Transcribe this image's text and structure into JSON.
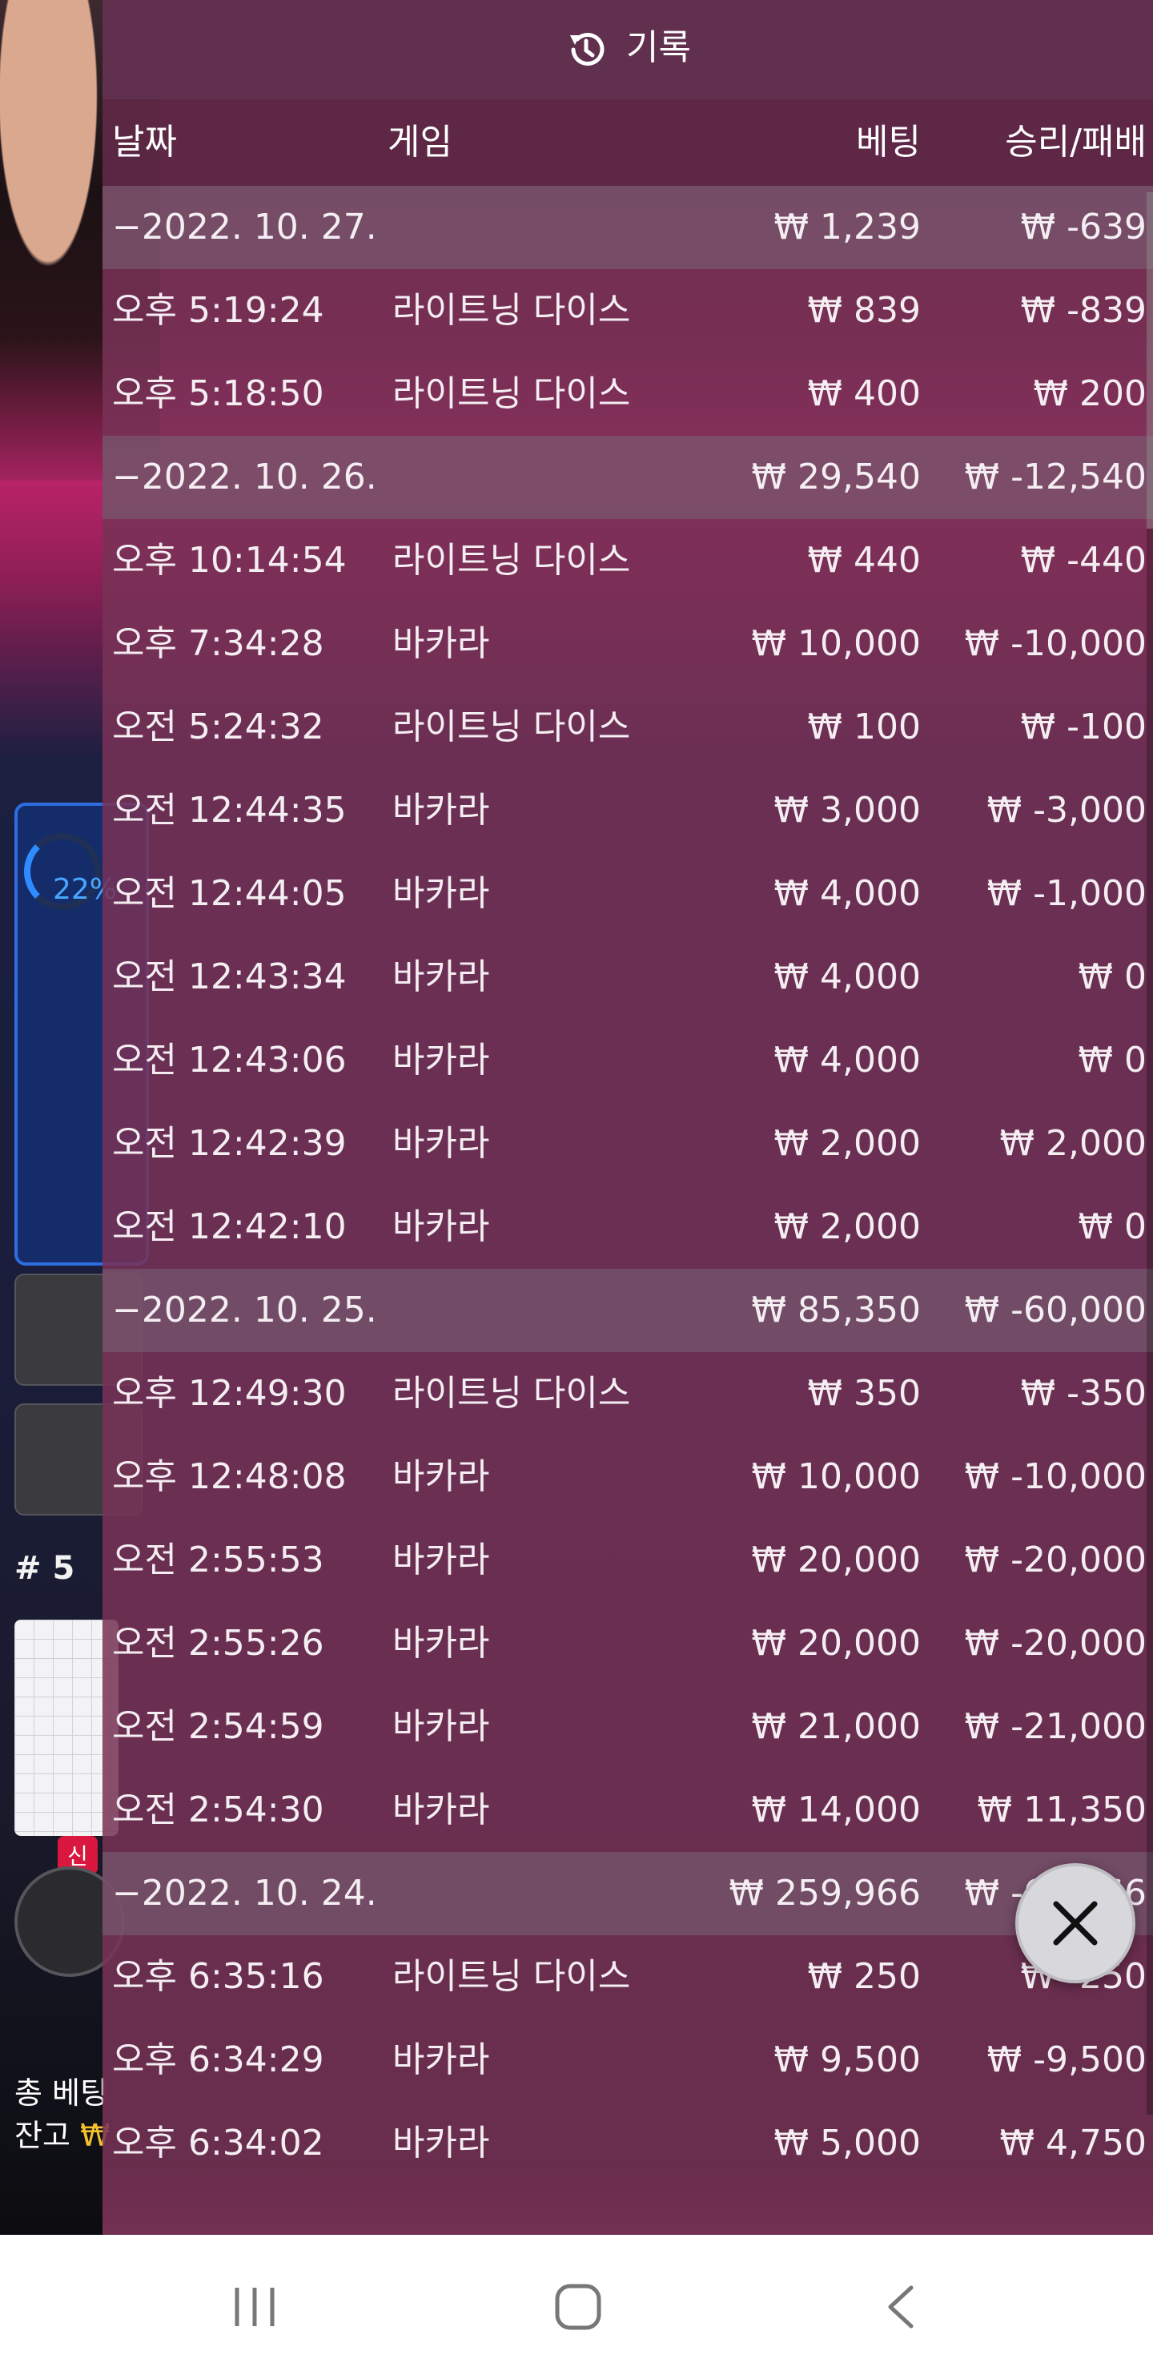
{
  "background": {
    "progress_percent": "22%",
    "hash_label": "# 5",
    "new_badge": "신",
    "total_bet_label": "총 베팅",
    "balance_label": "잔고",
    "balance_currency": "₩"
  },
  "panel": {
    "title": "기록",
    "icon": "history-icon"
  },
  "columns": {
    "date": "날짜",
    "game": "게임",
    "bet": "베팅",
    "win_loss": "승리/패배"
  },
  "rows": [
    {
      "type": "date",
      "date": "−2022. 10. 27.",
      "game": "",
      "bet": "₩ 1,239",
      "win": "₩ -639"
    },
    {
      "type": "entry",
      "date": "오후 5:19:24",
      "game": "라이트닝 다이스",
      "bet": "₩ 839",
      "win": "₩ -839"
    },
    {
      "type": "entry",
      "date": "오후 5:18:50",
      "game": "라이트닝 다이스",
      "bet": "₩ 400",
      "win": "₩ 200"
    },
    {
      "type": "date",
      "date": "−2022. 10. 26.",
      "game": "",
      "bet": "₩ 29,540",
      "win": "₩ -12,540"
    },
    {
      "type": "entry",
      "date": "오후 10:14:54",
      "game": "라이트닝 다이스",
      "bet": "₩ 440",
      "win": "₩ -440"
    },
    {
      "type": "entry",
      "date": "오후 7:34:28",
      "game": "바카라",
      "bet": "₩ 10,000",
      "win": "₩ -10,000"
    },
    {
      "type": "entry",
      "date": "오전 5:24:32",
      "game": "라이트닝 다이스",
      "bet": "₩ 100",
      "win": "₩ -100"
    },
    {
      "type": "entry",
      "date": "오전 12:44:35",
      "game": "바카라",
      "bet": "₩ 3,000",
      "win": "₩ -3,000"
    },
    {
      "type": "entry",
      "date": "오전 12:44:05",
      "game": "바카라",
      "bet": "₩ 4,000",
      "win": "₩ -1,000"
    },
    {
      "type": "entry",
      "date": "오전 12:43:34",
      "game": "바카라",
      "bet": "₩ 4,000",
      "win": "₩ 0"
    },
    {
      "type": "entry",
      "date": "오전 12:43:06",
      "game": "바카라",
      "bet": "₩ 4,000",
      "win": "₩ 0"
    },
    {
      "type": "entry",
      "date": "오전 12:42:39",
      "game": "바카라",
      "bet": "₩ 2,000",
      "win": "₩ 2,000"
    },
    {
      "type": "entry",
      "date": "오전 12:42:10",
      "game": "바카라",
      "bet": "₩ 2,000",
      "win": "₩ 0"
    },
    {
      "type": "date",
      "date": "−2022. 10. 25.",
      "game": "",
      "bet": "₩ 85,350",
      "win": "₩ -60,000"
    },
    {
      "type": "entry",
      "date": "오후 12:49:30",
      "game": "라이트닝 다이스",
      "bet": "₩ 350",
      "win": "₩ -350"
    },
    {
      "type": "entry",
      "date": "오후 12:48:08",
      "game": "바카라",
      "bet": "₩ 10,000",
      "win": "₩ -10,000"
    },
    {
      "type": "entry",
      "date": "오전 2:55:53",
      "game": "바카라",
      "bet": "₩ 20,000",
      "win": "₩ -20,000"
    },
    {
      "type": "entry",
      "date": "오전 2:55:26",
      "game": "바카라",
      "bet": "₩ 20,000",
      "win": "₩ -20,000"
    },
    {
      "type": "entry",
      "date": "오전 2:54:59",
      "game": "바카라",
      "bet": "₩ 21,000",
      "win": "₩ -21,000"
    },
    {
      "type": "entry",
      "date": "오전 2:54:30",
      "game": "바카라",
      "bet": "₩ 14,000",
      "win": "₩ 11,350"
    },
    {
      "type": "date",
      "date": "−2022. 10. 24.",
      "game": "",
      "bet": "₩ 259,966",
      "win": "₩ -68,366"
    },
    {
      "type": "entry",
      "date": "오후 6:35:16",
      "game": "라이트닝 다이스",
      "bet": "₩ 250",
      "win": "₩ -250"
    },
    {
      "type": "entry",
      "date": "오후 6:34:29",
      "game": "바카라",
      "bet": "₩ 9,500",
      "win": "₩ -9,500"
    },
    {
      "type": "entry",
      "date": "오후 6:34:02",
      "game": "바카라",
      "bet": "₩ 5,000",
      "win": "₩ 4,750"
    }
  ],
  "close_icon": "close-icon",
  "navbar": {
    "recent": "recent-apps-icon",
    "home": "home-icon",
    "back": "back-icon"
  }
}
